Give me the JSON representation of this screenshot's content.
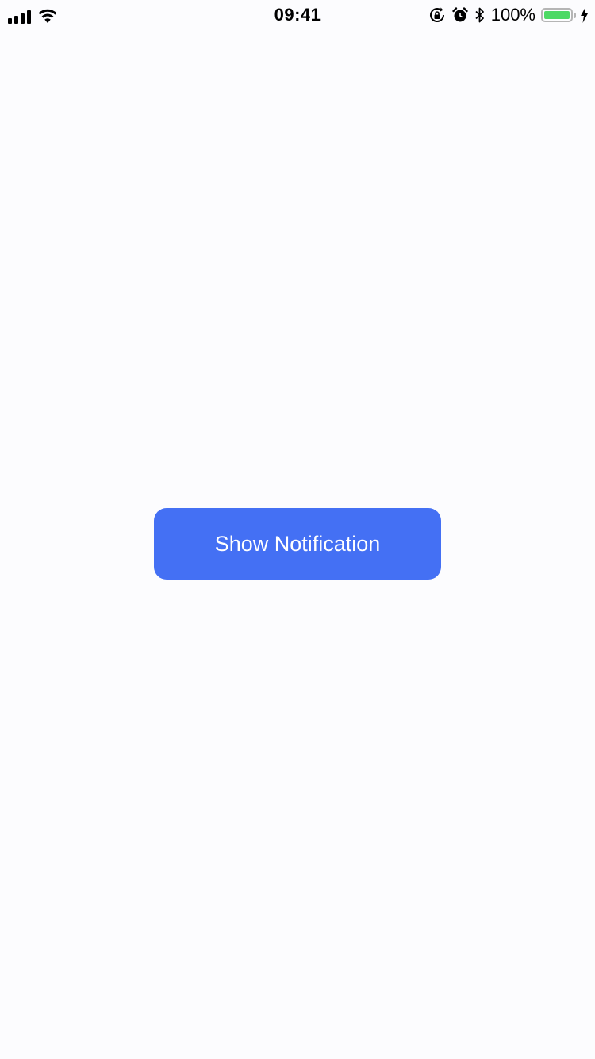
{
  "status_bar": {
    "time": "09:41",
    "battery_percent": "100%",
    "battery_level": 1.0,
    "icons": {
      "signal": "cellular-signal-icon",
      "wifi": "wifi-icon",
      "orientation_lock": "orientation-lock-icon",
      "alarm": "alarm-icon",
      "bluetooth": "bluetooth-icon",
      "battery": "battery-icon",
      "charging": "charging-bolt-icon"
    }
  },
  "main": {
    "show_notification_label": "Show Notification"
  },
  "colors": {
    "background": "#fcfcfe",
    "button": "#4470f4",
    "button_text": "#ffffff",
    "battery_fill": "#4cd964"
  }
}
